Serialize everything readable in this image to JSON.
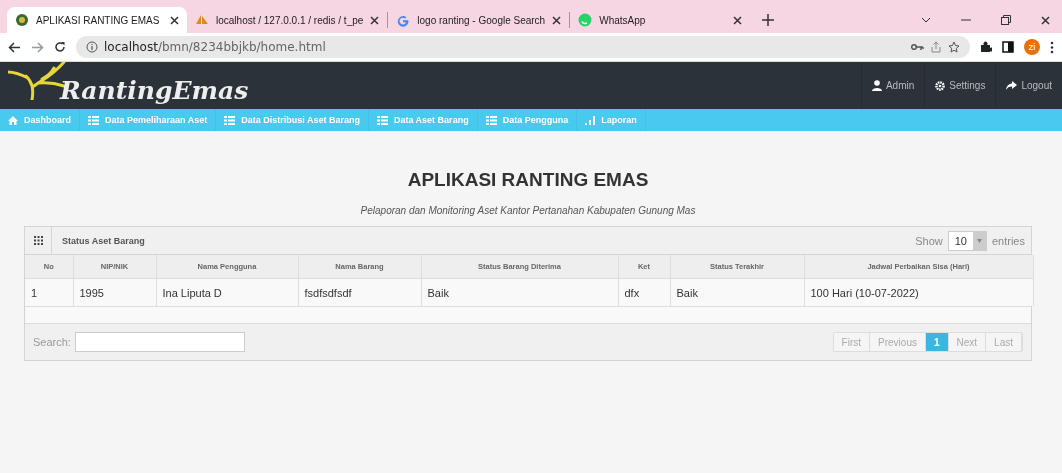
{
  "browser": {
    "tabs": [
      {
        "title": "APLIKASI RANTING EMAS",
        "selected": true
      },
      {
        "title": "localhost / 127.0.0.1 / redis / t_pe",
        "selected": false
      },
      {
        "title": "logo ranting - Google Search",
        "selected": false
      },
      {
        "title": "WhatsApp",
        "selected": false
      }
    ],
    "address": {
      "host": "localhost",
      "path": "/bmn/8234bbjkb/home.html"
    },
    "profile": "zi"
  },
  "header": {
    "brand": "RantingEmas",
    "menu": [
      "Admin",
      "Settings",
      "Logout"
    ]
  },
  "nav": [
    "Dashboard",
    "Data Pemeliharaan Aset",
    "Data Distribusi Aset Barang",
    "Data Aset Barang",
    "Data Pengguna",
    "Laporan"
  ],
  "page": {
    "title": "APLIKASI RANTING EMAS",
    "subtitle": "Pelaporan dan Monitoring Aset Kantor Pertanahan Kabupaten Gunung Mas"
  },
  "panel": {
    "title": "Status Aset Barang",
    "show_label": "Show",
    "page_size": "10",
    "entries_label": "entries",
    "columns": [
      "No",
      "NIP/NIK",
      "Nama Pengguna",
      "Nama Barang",
      "Status Barang Diterima",
      "Ket",
      "Status Terakhir",
      "Jadwal Perbaikan Sisa (Hari)"
    ],
    "rows": [
      [
        "1",
        "1995",
        "Ina Liputa D",
        "fsdfsdfsdf",
        "Baik",
        "dfx",
        "Baik",
        "100 Hari (10-07-2022)"
      ]
    ],
    "search_label": "Search:",
    "pagination": [
      {
        "label": "First",
        "selected": false
      },
      {
        "label": "Previous",
        "selected": false
      },
      {
        "label": "1",
        "selected": true
      },
      {
        "label": "Next",
        "selected": false
      },
      {
        "label": "Last",
        "selected": false
      }
    ]
  }
}
